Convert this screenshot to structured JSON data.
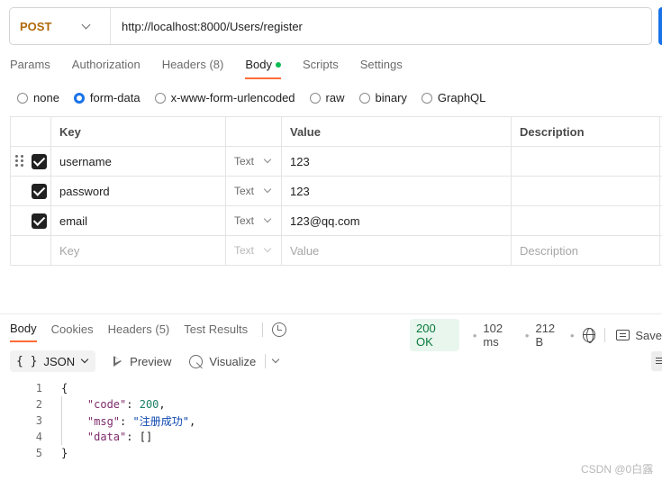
{
  "request": {
    "method": "POST",
    "url": "http://localhost:8000/Users/register"
  },
  "request_tabs": [
    {
      "label": "Params"
    },
    {
      "label": "Authorization"
    },
    {
      "label": "Headers",
      "count": "(8)"
    },
    {
      "label": "Body",
      "active": true,
      "indicator_color": "#0cbb52"
    },
    {
      "label": "Scripts"
    },
    {
      "label": "Settings"
    }
  ],
  "body_types": [
    {
      "label": "none",
      "checked": false
    },
    {
      "label": "form-data",
      "checked": true
    },
    {
      "label": "x-www-form-urlencoded",
      "checked": false
    },
    {
      "label": "raw",
      "checked": false
    },
    {
      "label": "binary",
      "checked": false
    },
    {
      "label": "GraphQL",
      "checked": false
    }
  ],
  "form_table": {
    "headers": {
      "key": "Key",
      "value": "Value",
      "description": "Description"
    },
    "rows": [
      {
        "checked": true,
        "key": "username",
        "type": "Text",
        "value": "123",
        "description": ""
      },
      {
        "checked": true,
        "key": "password",
        "type": "Text",
        "value": "123",
        "description": ""
      },
      {
        "checked": true,
        "key": "email",
        "type": "Text",
        "value": "123@qq.com",
        "description": ""
      }
    ],
    "empty_row": {
      "key_placeholder": "Key",
      "type": "Text",
      "value_placeholder": "Value",
      "description_placeholder": "Description"
    }
  },
  "response_tabs": [
    {
      "label": "Body",
      "active": true
    },
    {
      "label": "Cookies"
    },
    {
      "label": "Headers",
      "count": "(5)"
    },
    {
      "label": "Test Results"
    }
  ],
  "response_meta": {
    "status": "200 OK",
    "time": "102 ms",
    "size": "212 B",
    "save_label": "Save"
  },
  "response_toolbar": {
    "format": "JSON",
    "preview": "Preview",
    "visualize": "Visualize"
  },
  "code": {
    "line_numbers": [
      "1",
      "2",
      "3",
      "4",
      "5"
    ],
    "open": "{",
    "close": "}",
    "fields": [
      {
        "key": "\"code\"",
        "value": "200",
        "type": "number"
      },
      {
        "key": "\"msg\"",
        "value": "\"注册成功\"",
        "type": "string"
      },
      {
        "key": "\"data\"",
        "value": "[]",
        "type": "array"
      }
    ]
  },
  "watermark": "CSDN @0白露",
  "colors": {
    "method": "#b0690a",
    "accent_tab": "#ff6c37",
    "radio_checked": "#1a73e8",
    "status_bg": "#e8f6ee",
    "status_text": "#0a7a3c"
  }
}
